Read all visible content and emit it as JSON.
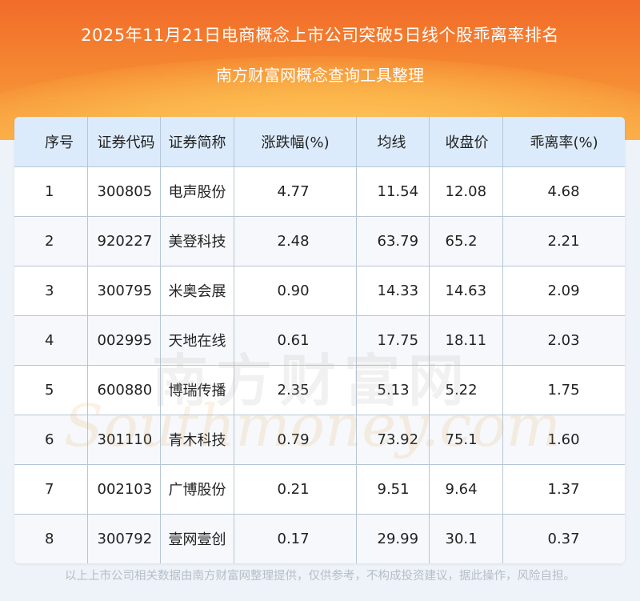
{
  "header": {
    "title": "2025年11月21日电商概念上市公司突破5日线个股乖离率排名",
    "subtitle": "南方财富网概念查询工具整理"
  },
  "table": {
    "columns": [
      "序号",
      "证券代码",
      "证券简称",
      "涨跌幅(%)",
      "均线",
      "收盘价",
      "乖离率(%)"
    ],
    "rows": [
      [
        "1",
        "300805",
        "电声股份",
        "4.77",
        "11.54",
        "12.08",
        "4.68"
      ],
      [
        "2",
        "920227",
        "美登科技",
        "2.48",
        "63.79",
        "65.2",
        "2.21"
      ],
      [
        "3",
        "300795",
        "米奥会展",
        "0.90",
        "14.33",
        "14.63",
        "2.09"
      ],
      [
        "4",
        "002995",
        "天地在线",
        "0.61",
        "17.75",
        "18.11",
        "2.03"
      ],
      [
        "5",
        "600880",
        "博瑞传播",
        "2.35",
        "5.13",
        "5.22",
        "1.75"
      ],
      [
        "6",
        "301110",
        "青木科技",
        "0.79",
        "73.92",
        "75.1",
        "1.60"
      ],
      [
        "7",
        "002103",
        "广博股份",
        "0.21",
        "9.51",
        "9.64",
        "1.37"
      ],
      [
        "8",
        "300792",
        "壹网壹创",
        "0.17",
        "29.99",
        "30.1",
        "0.37"
      ]
    ]
  },
  "watermark": {
    "cn": "南方财富网",
    "en": "Southmoney.com"
  },
  "footer": {
    "disclaimer": "以上上市公司相关数据由南方财富网整理提供，仅供参考，不构成投资建议，据此操作，风险自担。"
  },
  "colors": {
    "banner_top": "#f26b2a",
    "banner_bottom": "#f8a545",
    "header_row": "#dcebfb",
    "grid_line": "#b7c6d6",
    "page_bg": "#eef3f9"
  }
}
